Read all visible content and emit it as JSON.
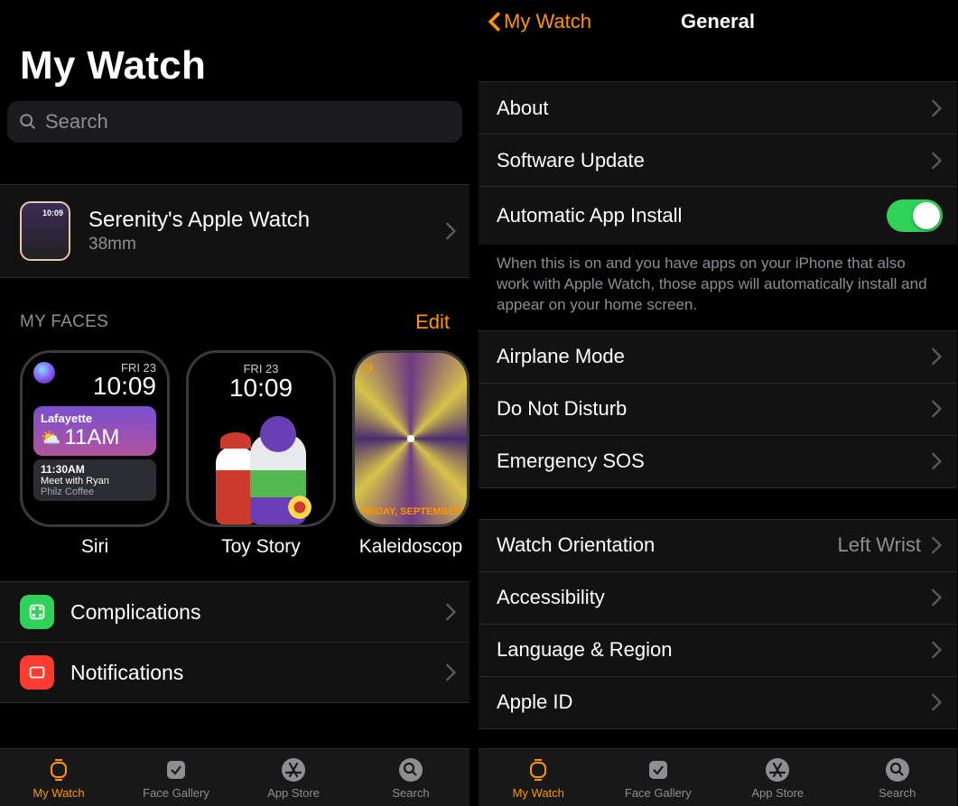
{
  "left": {
    "title": "My Watch",
    "search_placeholder": "Search",
    "watch": {
      "name": "Serenity's Apple Watch",
      "size": "38mm"
    },
    "faces_header": "MY FACES",
    "edit_label": "Edit",
    "faces": [
      {
        "name": "Siri",
        "date": "FRI 23",
        "time": "10:09",
        "city": "Lafayette",
        "temp": "11AM",
        "alarm": "11:30AM",
        "meeting1": "Meet with Ryan",
        "meeting2": "Philz Coffee"
      },
      {
        "name": "Toy Story",
        "date": "FRI 23",
        "time": "10:09"
      },
      {
        "name": "Kaleidoscop",
        "badge": "ʊ",
        "date": "FRIDAY, SEPTEMBER"
      }
    ],
    "settings": [
      {
        "label": "Complications",
        "icon": "green"
      },
      {
        "label": "Notifications",
        "icon": "red"
      }
    ]
  },
  "right": {
    "back_label": "My Watch",
    "title": "General",
    "group1": [
      {
        "label": "About"
      },
      {
        "label": "Software Update"
      }
    ],
    "auto_install_label": "Automatic App Install",
    "auto_install_note": "When this is on and you have apps on your iPhone that also work with Apple Watch, those apps will automatically install and appear on your home screen.",
    "group2": [
      {
        "label": "Airplane Mode"
      },
      {
        "label": "Do Not Disturb"
      },
      {
        "label": "Emergency SOS"
      }
    ],
    "group3": [
      {
        "label": "Watch Orientation",
        "value": "Left Wrist"
      },
      {
        "label": "Accessibility"
      },
      {
        "label": "Language & Region"
      },
      {
        "label": "Apple ID"
      }
    ]
  },
  "tabs": [
    {
      "label": "My Watch",
      "icon": "watch"
    },
    {
      "label": "Face Gallery",
      "icon": "gallery"
    },
    {
      "label": "App Store",
      "icon": "appstore"
    },
    {
      "label": "Search",
      "icon": "search"
    }
  ]
}
